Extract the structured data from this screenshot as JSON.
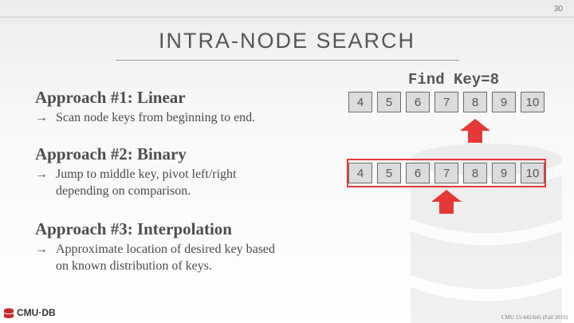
{
  "slide_number": "30",
  "title": "INTRA-NODE SEARCH",
  "approaches": [
    {
      "heading": "Approach #1: Linear",
      "lines": [
        "Scan node keys from beginning to end."
      ]
    },
    {
      "heading": "Approach #2: Binary",
      "lines": [
        "Jump to middle key, pivot left/right",
        "depending on comparison."
      ]
    },
    {
      "heading": "Approach #3: Interpolation",
      "lines": [
        "Approximate location of desired key based",
        "on known distribution of keys."
      ]
    }
  ],
  "arrow_glyph": "→",
  "find_key_label": "Find Key=8",
  "arrays": [
    {
      "keys": [
        "4",
        "5",
        "6",
        "7",
        "8",
        "9",
        "10"
      ],
      "pointer_index": 4,
      "highlighted": false
    },
    {
      "keys": [
        "4",
        "5",
        "6",
        "7",
        "8",
        "9",
        "10"
      ],
      "pointer_index": 3,
      "highlighted": true
    }
  ],
  "colors": {
    "pointer": "#e53935",
    "highlight": "#e53935",
    "cell_fill": "#dcdcdc"
  },
  "logo_icon": "database-icon",
  "footer": {
    "logo": "CMU·DB",
    "course": "CMU 15-445/645 (Fall 2019)"
  }
}
